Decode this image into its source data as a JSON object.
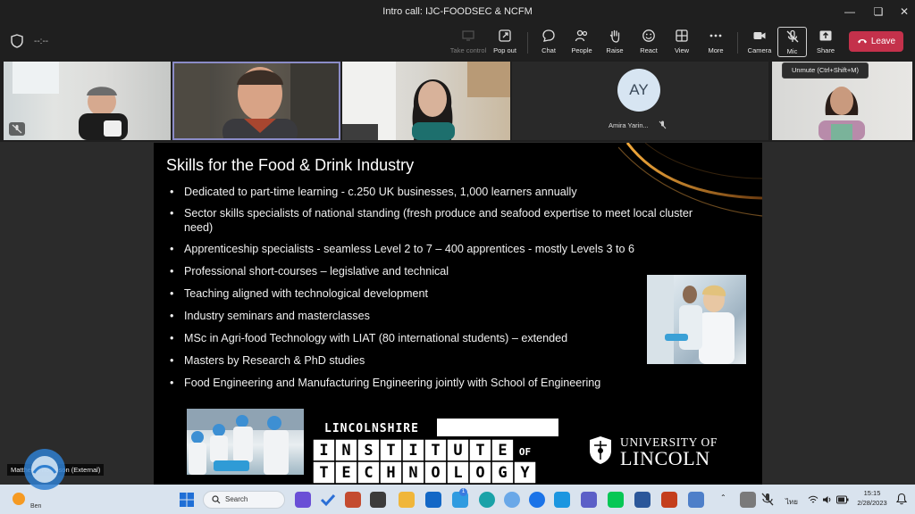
{
  "window": {
    "title": "Intro call: IJC-FOODSEC & NCFM"
  },
  "toolbar": {
    "timer": "--:--",
    "buttons": {
      "take_control": "Take control",
      "pop_out": "Pop out",
      "chat": "Chat",
      "people": "People",
      "raise": "Raise",
      "react": "React",
      "view": "View",
      "more": "More",
      "camera": "Camera",
      "mic": "Mic",
      "share": "Share"
    },
    "leave": "Leave",
    "tooltip": "Unmute (Ctrl+Shift+M)"
  },
  "participants": {
    "avatar_initials": "AY",
    "avatar_name": "Amira Yarin...",
    "presenter_name": "Matthew Thompson (External)"
  },
  "slide": {
    "title": "Skills for the Food & Drink Industry",
    "bullets": [
      "Dedicated to part-time learning  - c.250 UK businesses, 1,000   learners annually",
      "Sector skills specialists of national standing (fresh produce and seafood expertise to meet local cluster need)",
      "Apprenticeship specialists - seamless Level 2 to 7 – 400 apprentices - mostly Levels 3 to 6",
      "Professional short-courses – legislative and technical",
      "Teaching aligned with technological development",
      "Industry seminars and masterclasses",
      "MSc in Agri-food Technology with LIAT (80 international students) – extended",
      "Masters by Research & PhD studies",
      "Food Engineering and Manufacturing Engineering jointly with School of Engineering"
    ],
    "logo_lit": {
      "top": "LINCOLNSHIRE",
      "row1": [
        "I",
        "N",
        "S",
        "T",
        "I",
        "T",
        "U",
        "T",
        "E"
      ],
      "of": "OF",
      "row2": [
        "T",
        "E",
        "C",
        "H",
        "N",
        "O",
        "L",
        "O",
        "G",
        "Y"
      ]
    },
    "logo_uol": {
      "line1": "UNIVERSITY OF",
      "line2": "LINCOLN"
    }
  },
  "taskbar": {
    "weather_label": "Ben",
    "search": "Search",
    "notification_count": "1",
    "lang": "ไทย",
    "time": "15:15",
    "date": "2/28/2023"
  },
  "colors": {
    "leave": "#c4314b",
    "active_speaker": "#8b8cc7",
    "taskbar": "#d9e3ee"
  }
}
